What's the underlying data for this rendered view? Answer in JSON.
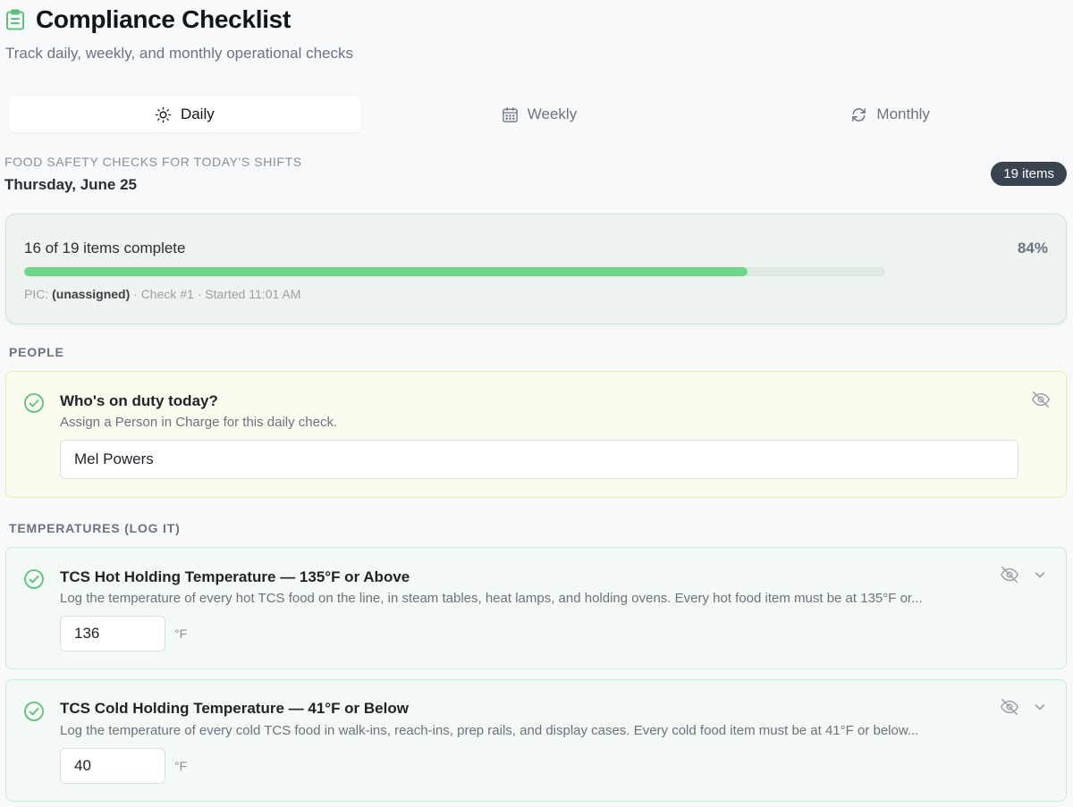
{
  "header": {
    "title": "Compliance Checklist",
    "subtitle": "Track daily, weekly, and monthly operational checks"
  },
  "tabs": [
    {
      "label": "Daily",
      "icon": "sun-icon",
      "active": true
    },
    {
      "label": "Weekly",
      "icon": "calendar-icon",
      "active": false
    },
    {
      "label": "Monthly",
      "icon": "refresh-icon",
      "active": false
    }
  ],
  "day": {
    "caption": "FOOD SAFETY CHECKS FOR TODAY'S SHIFTS",
    "date": "Thursday, June 25",
    "badge": "19 items"
  },
  "progress": {
    "summary": "16 of 19 items complete",
    "percent": "84%",
    "fraction": 0.84,
    "pic_label": "PIC:",
    "pic_value": "(unassigned)",
    "meta_suffix": "· Check #1 · Started 11:01 AM"
  },
  "sections": {
    "people": "PEOPLE",
    "temperatures": "TEMPERATURES (LOG IT)"
  },
  "items": {
    "duty": {
      "title": "Who's on duty today?",
      "desc": "Assign a Person in Charge for this daily check.",
      "value": "Mel Powers"
    },
    "hot": {
      "title": "TCS Hot Holding Temperature — 135°F or Above",
      "desc": "Log the temperature of every hot TCS food on the line, in steam tables, heat lamps, and holding ovens. Every hot food item must be at 135°F or...",
      "value": "136",
      "unit": "°F"
    },
    "cold": {
      "title": "TCS Cold Holding Temperature — 41°F or Below",
      "desc": "Log the temperature of every cold TCS food in walk-ins, reach-ins, prep rails, and display cases. Every cold food item must be at 41°F or below...",
      "value": "40",
      "unit": "°F"
    }
  },
  "colors": {
    "accent_green": "#5cc07a",
    "progress_fill": "#6dd68a",
    "badge_bg": "#3a4350",
    "duty_card_border": "#f1e6a3",
    "temp_card_border": "#c9ead2"
  }
}
